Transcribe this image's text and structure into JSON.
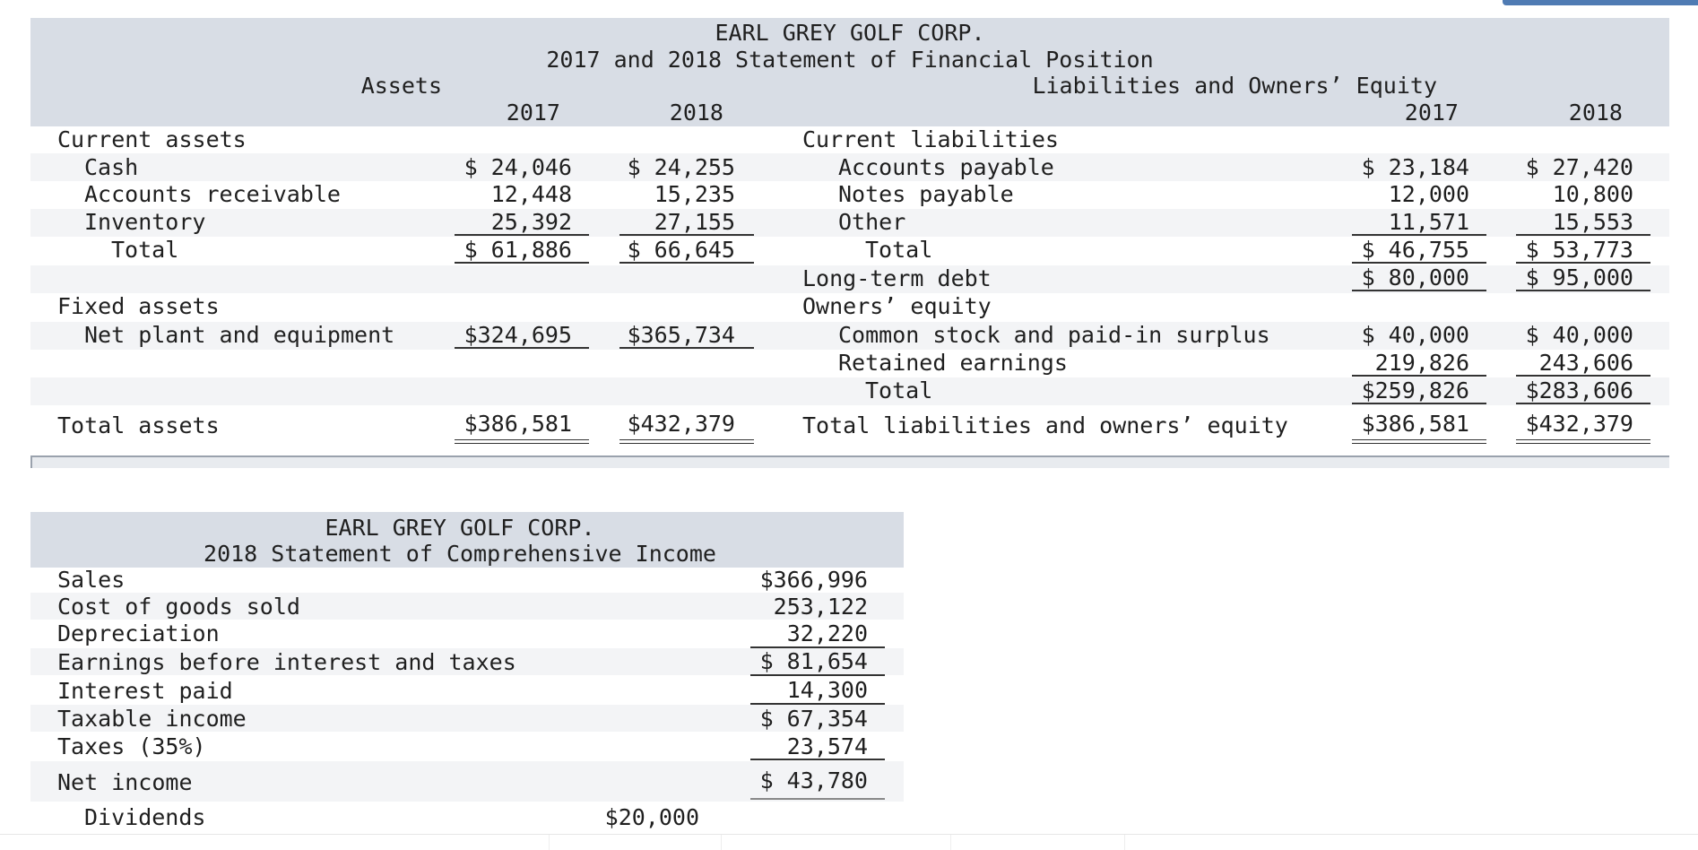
{
  "balance_sheet": {
    "company": "EARL GREY GOLF CORP.",
    "title": "2017 and 2018 Statement of Financial Position",
    "assets_header": "Assets",
    "liabilities_header": "Liabilities and Owners’ Equity",
    "year_2017": "2017",
    "year_2018": "2018",
    "current_assets": {
      "label": "Current assets",
      "cash": {
        "label": "Cash",
        "v2017": "$ 24,046",
        "v2018": "$ 24,255"
      },
      "accounts_receivable": {
        "label": "Accounts receivable",
        "v2017": "12,448",
        "v2018": "15,235"
      },
      "inventory": {
        "label": "Inventory",
        "v2017": "25,392",
        "v2018": "27,155"
      },
      "total": {
        "label": "Total",
        "v2017": "$ 61,886",
        "v2018": "$ 66,645"
      }
    },
    "fixed_assets": {
      "label": "Fixed assets",
      "net_plant": {
        "label": "Net plant and equipment",
        "v2017": "$324,695",
        "v2018": "$365,734"
      }
    },
    "total_assets": {
      "label": "Total assets",
      "v2017": "$386,581",
      "v2018": "$432,379"
    },
    "current_liabilities": {
      "label": "Current liabilities",
      "accounts_payable": {
        "label": "Accounts payable",
        "v2017": "$ 23,184",
        "v2018": "$ 27,420"
      },
      "notes_payable": {
        "label": "Notes payable",
        "v2017": "12,000",
        "v2018": "10,800"
      },
      "other": {
        "label": "Other",
        "v2017": "11,571",
        "v2018": "15,553"
      },
      "total": {
        "label": "Total",
        "v2017": "$ 46,755",
        "v2018": "$ 53,773"
      }
    },
    "long_term_debt": {
      "label": "Long-term debt",
      "v2017": "$ 80,000",
      "v2018": "$ 95,000"
    },
    "owners_equity": {
      "label": "Owners’ equity",
      "common_stock": {
        "label": "Common stock and paid-in surplus",
        "v2017": "$ 40,000",
        "v2018": "$ 40,000"
      },
      "retained_earnings": {
        "label": "Retained earnings",
        "v2017": "219,826",
        "v2018": "243,606"
      },
      "total": {
        "label": "Total",
        "v2017": "$259,826",
        "v2018": "$283,606"
      }
    },
    "total_liabilities": {
      "label": "Total liabilities and owners’ equity",
      "v2017": "$386,581",
      "v2018": "$432,379"
    }
  },
  "income_statement": {
    "company": "EARL GREY GOLF CORP.",
    "title": "2018 Statement of Comprehensive Income",
    "sales": {
      "label": "Sales",
      "value": "$366,996"
    },
    "cogs": {
      "label": "Cost of goods sold",
      "value": "253,122"
    },
    "depreciation": {
      "label": "Depreciation",
      "value": "32,220"
    },
    "ebit": {
      "label": "Earnings before interest and taxes",
      "value": "$ 81,654"
    },
    "interest": {
      "label": "Interest paid",
      "value": "14,300"
    },
    "taxable_income": {
      "label": "Taxable income",
      "value": "$ 67,354"
    },
    "taxes": {
      "label": "Taxes (35%)",
      "value": "23,574"
    },
    "net_income": {
      "label": "Net income",
      "value": "$ 43,780"
    },
    "dividends": {
      "label": "Dividends",
      "value": "$20,000"
    }
  }
}
